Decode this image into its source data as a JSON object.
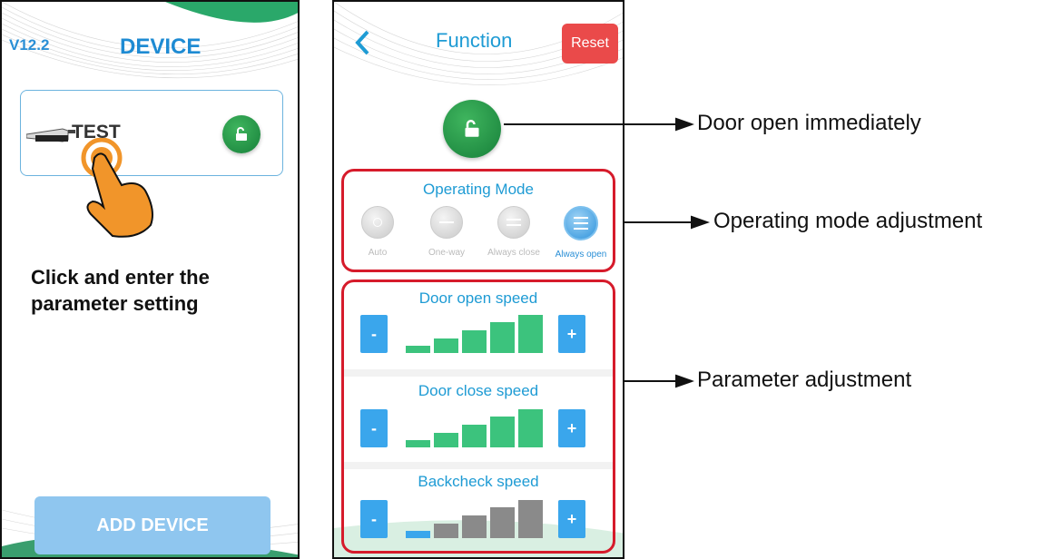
{
  "screen1": {
    "version": "V12.2",
    "title": "DEVICE",
    "device_name": "TEST",
    "caption_line1": "Click and enter the",
    "caption_line2": "parameter setting",
    "add_button": "ADD DEVICE"
  },
  "screen2": {
    "title": "Function",
    "reset": "Reset",
    "operating_mode": {
      "title": "Operating Mode",
      "modes": [
        {
          "label": "Auto",
          "selected": false
        },
        {
          "label": "One-way",
          "selected": false
        },
        {
          "label": "Always close",
          "selected": false
        },
        {
          "label": "Always open",
          "selected": true
        }
      ]
    },
    "door_open_speed": {
      "title": "Door open speed",
      "minus": "-",
      "plus": "+",
      "level": 5,
      "max": 5
    },
    "door_close_speed": {
      "title": "Door close speed",
      "minus": "-",
      "plus": "+",
      "level": 5,
      "max": 5
    },
    "backcheck_speed": {
      "title": "Backcheck speed",
      "minus": "-",
      "plus": "+",
      "level": 1,
      "max": 5
    }
  },
  "annotations": {
    "door_open": "Door open immediately",
    "operating_mode": "Operating mode adjustment",
    "parameter": "Parameter adjustment"
  },
  "colors": {
    "accent_blue": "#1e9bd4",
    "green_bar": "#3cc37d",
    "blue_bar": "#3aa6ec",
    "gray_bar": "#8a8a8a",
    "red_frame": "#d61b2b",
    "reset_red": "#ea4a4a"
  }
}
